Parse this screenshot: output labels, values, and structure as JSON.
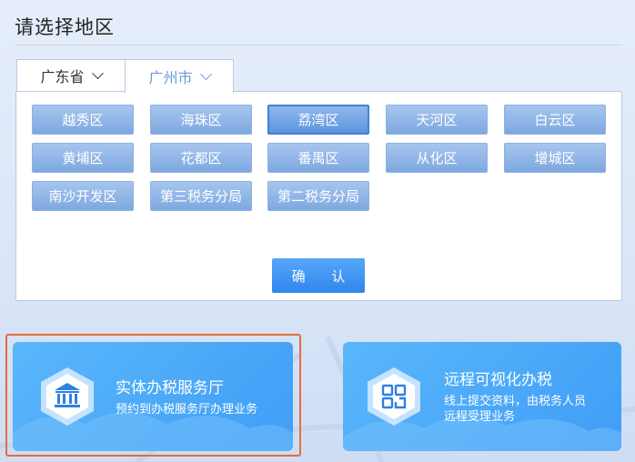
{
  "page": {
    "title": "请选择地区"
  },
  "tabs": {
    "province": "广东省",
    "city": "广州市"
  },
  "districts": [
    "越秀区",
    "海珠区",
    "荔湾区",
    "天河区",
    "白云区",
    "黄埔区",
    "花都区",
    "番禺区",
    "从化区",
    "增城区",
    "南沙开发区",
    "第三税务分局",
    "第二税务分局"
  ],
  "selected_district": "荔湾区",
  "confirm_label": "确 认",
  "cards": {
    "physical": {
      "title": "实体办税服务厅",
      "desc": "预约到办税服务厅办理业务",
      "icon": "bank-icon"
    },
    "remote": {
      "title": "远程可视化办税",
      "desc_line1": "线上提交资料，由税务人员",
      "desc_line2": "远程受理业务",
      "icon": "video-call-icon"
    }
  },
  "colors": {
    "accent": "#3f9df6",
    "district_btn": "#8db0e3",
    "highlight": "#e06f3c",
    "city_tab_text": "#6a9bd6"
  }
}
